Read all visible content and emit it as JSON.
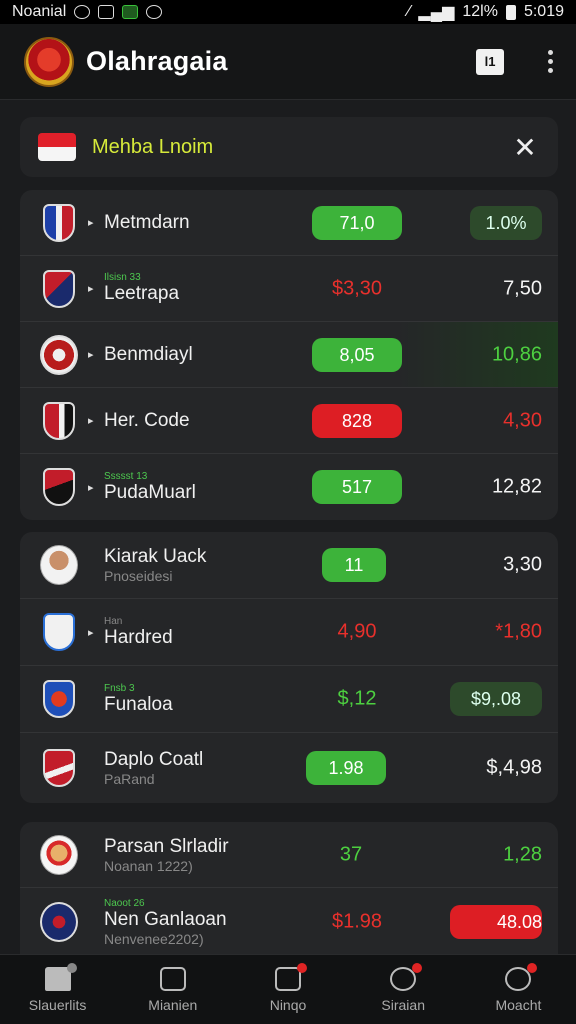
{
  "status": {
    "carrier": "Noanial",
    "battery": "12l%",
    "time": "5:019"
  },
  "app": {
    "title": "Olahragaia",
    "box_label": "l1"
  },
  "banner": {
    "text": "Mehba Lnoim",
    "close": "✕"
  },
  "card1": [
    {
      "name": "Metmdarn",
      "tiny": "",
      "val1": "71,0",
      "val1_style": "green",
      "val2": "1.0%",
      "val2_style": "darkgreen"
    },
    {
      "name": "Leetrapa",
      "tiny": "Ilsisn 33",
      "val1": "$3,30",
      "val1_style": "red-text",
      "val2": "7,50",
      "val2_style": "white"
    },
    {
      "name": "Benmdiayl",
      "tiny": "",
      "val1": "8,05",
      "val1_style": "green",
      "val2": "10,86",
      "val2_style": "green-text"
    },
    {
      "name": "Her. Code",
      "tiny": "",
      "val1": "828",
      "val1_style": "red",
      "val2": "4,30",
      "val2_style": "red-text"
    },
    {
      "name": "PudaMuarl",
      "tiny": "Ssssst 13",
      "val1": "517",
      "val1_style": "green",
      "val2": "12,82",
      "val2_style": "white"
    }
  ],
  "card2": [
    {
      "name": "Kiarak Uack",
      "sub": "Pnoseidesi",
      "tiny": "",
      "val1": "11",
      "val1_style": "green",
      "val2": "3,30",
      "val2_style": "white"
    },
    {
      "name": "Hardred",
      "sub": "",
      "tiny": "Han",
      "val1": "4,90",
      "val1_style": "red-text",
      "val2": "*1,80",
      "val2_style": "red-text"
    },
    {
      "name": "Funaloa",
      "sub": "",
      "tiny": "Fnsb 3",
      "val1": "$,12",
      "val1_style": "green-text",
      "val2": "$9,.08",
      "val2_style": "darkgreen"
    },
    {
      "name": "Daplo Coatl",
      "sub": "PaRand",
      "tiny": "",
      "val1": "1.98",
      "val1_style": "green",
      "val2": "$,4,98",
      "val2_style": "white"
    }
  ],
  "card3": [
    {
      "name": "Parsan Slrladir",
      "sub": "Noanan 1222)",
      "tiny": "",
      "val1": "37",
      "val1_style": "green-text",
      "val2": "1,28",
      "val2_style": "green-text"
    },
    {
      "name": "Nen Ganlaoan",
      "sub": "Nenvenee2202)",
      "tiny": "Naoot 26",
      "val1": "$1.98",
      "val1_style": "red-text",
      "val2": "48.08",
      "val2_style": "red"
    }
  ],
  "nav": [
    {
      "label": "Slauerlits"
    },
    {
      "label": "Mianien"
    },
    {
      "label": "Ninqo"
    },
    {
      "label": "Siraian"
    },
    {
      "label": "Moacht"
    }
  ]
}
